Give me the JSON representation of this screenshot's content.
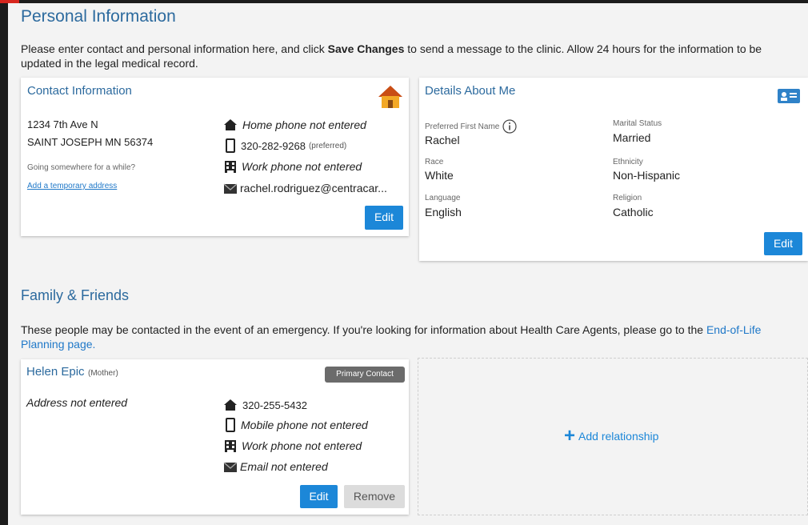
{
  "personal": {
    "title": "Personal Information",
    "intro_pre": "Please enter contact and personal information here, and click ",
    "intro_bold": "Save Changes",
    "intro_post": " to send a message to the clinic. Allow 24 hours for the information to be",
    "intro_line2": "updated in the legal medical record."
  },
  "contact": {
    "title": "Contact Information",
    "address_line1": "1234 7th Ave N",
    "address_line2": "SAINT JOSEPH MN 56374",
    "going_somewhere": "Going somewhere for a while?",
    "add_temp_address": "Add a temporary address",
    "home_phone": "Home phone not entered",
    "mobile_phone": "320-282-9268",
    "mobile_note": "(preferred)",
    "work_phone": "Work phone not entered",
    "email": "rachel.rodriguez@centracar...",
    "edit_label": "Edit"
  },
  "details": {
    "title": "Details About Me",
    "preferred_name_label": "Preferred First Name",
    "preferred_name": "Rachel",
    "marital_label": "Marital Status",
    "marital": "Married",
    "race_label": "Race",
    "race": "White",
    "ethnicity_label": "Ethnicity",
    "ethnicity": "Non-Hispanic",
    "language_label": "Language",
    "language": "English",
    "religion_label": "Religion",
    "religion": "Catholic",
    "edit_label": "Edit"
  },
  "family": {
    "title": "Family & Friends",
    "intro_pre": "These people may be contacted in the event of an emergency. If you're looking for information about Health Care Agents, please go to the ",
    "intro_link_a": "End-of-Life",
    "intro_link_b": "Planning page."
  },
  "relation": {
    "name": "Helen Epic",
    "relationship": "(Mother)",
    "badge": "Primary Contact",
    "address": "Address not entered",
    "home_phone": "320-255-5432",
    "mobile_phone": "Mobile phone not entered",
    "work_phone": "Work phone not entered",
    "email": "Email not entered",
    "edit_label": "Edit",
    "remove_label": "Remove"
  },
  "add_relationship": {
    "plus": "+",
    "label": "Add relationship"
  },
  "colors": {
    "heading": "#2c6a9e",
    "button": "#1c87d8",
    "link": "#1f78c8",
    "house_roof": "#c94d14",
    "house_body": "#f3a825"
  }
}
